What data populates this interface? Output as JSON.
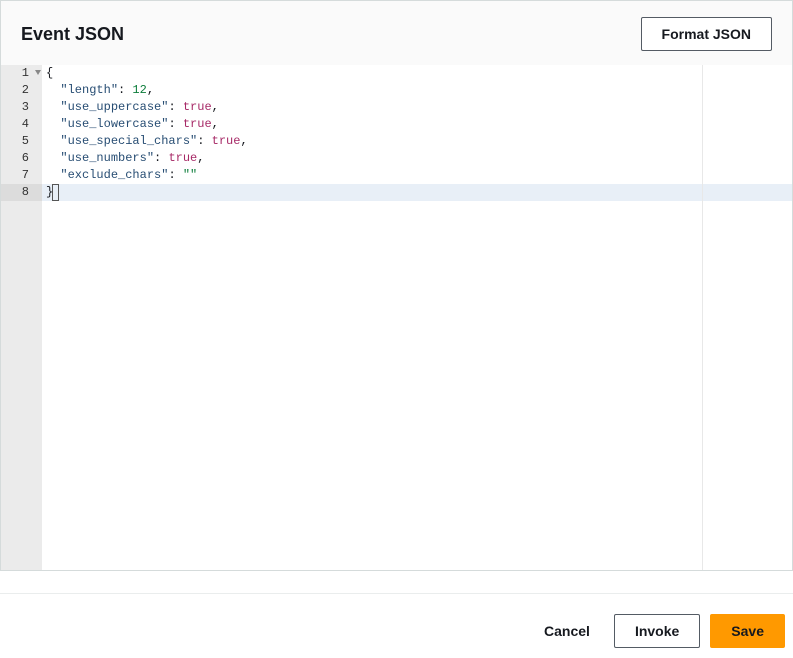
{
  "panel": {
    "title": "Event JSON",
    "format_button": "Format JSON"
  },
  "editor": {
    "lines": [
      {
        "num": 1,
        "indent": "",
        "tokens": [
          {
            "t": "brace",
            "v": "{"
          }
        ],
        "fold": true
      },
      {
        "num": 2,
        "indent": "  ",
        "tokens": [
          {
            "t": "key",
            "v": "\"length\""
          },
          {
            "t": "punc",
            "v": ": "
          },
          {
            "t": "number",
            "v": "12"
          },
          {
            "t": "punc",
            "v": ","
          }
        ]
      },
      {
        "num": 3,
        "indent": "  ",
        "tokens": [
          {
            "t": "key",
            "v": "\"use_uppercase\""
          },
          {
            "t": "punc",
            "v": ": "
          },
          {
            "t": "bool",
            "v": "true"
          },
          {
            "t": "punc",
            "v": ","
          }
        ]
      },
      {
        "num": 4,
        "indent": "  ",
        "tokens": [
          {
            "t": "key",
            "v": "\"use_lowercase\""
          },
          {
            "t": "punc",
            "v": ": "
          },
          {
            "t": "bool",
            "v": "true"
          },
          {
            "t": "punc",
            "v": ","
          }
        ]
      },
      {
        "num": 5,
        "indent": "  ",
        "tokens": [
          {
            "t": "key",
            "v": "\"use_special_chars\""
          },
          {
            "t": "punc",
            "v": ": "
          },
          {
            "t": "bool",
            "v": "true"
          },
          {
            "t": "punc",
            "v": ","
          }
        ]
      },
      {
        "num": 6,
        "indent": "  ",
        "tokens": [
          {
            "t": "key",
            "v": "\"use_numbers\""
          },
          {
            "t": "punc",
            "v": ": "
          },
          {
            "t": "bool",
            "v": "true"
          },
          {
            "t": "punc",
            "v": ","
          }
        ]
      },
      {
        "num": 7,
        "indent": "  ",
        "tokens": [
          {
            "t": "key",
            "v": "\"exclude_chars\""
          },
          {
            "t": "punc",
            "v": ": "
          },
          {
            "t": "string",
            "v": "\"\""
          }
        ]
      },
      {
        "num": 8,
        "indent": "",
        "tokens": [
          {
            "t": "brace",
            "v": "}"
          }
        ],
        "active": true
      }
    ]
  },
  "footer": {
    "cancel": "Cancel",
    "invoke": "Invoke",
    "save": "Save"
  }
}
